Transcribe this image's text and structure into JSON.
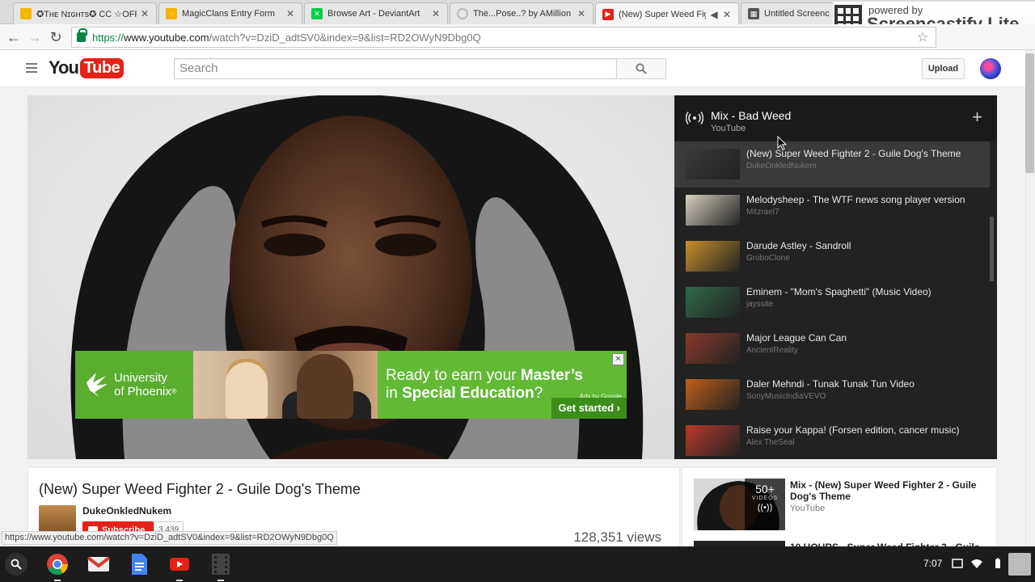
{
  "browser": {
    "tabs": [
      {
        "title": "✪Tʜᴇ Nɪɢʜᴛs✪ CC ☆OFF",
        "favicon": "bulb-icon",
        "color": "#f4b400"
      },
      {
        "title": "MagicClans Entry Form",
        "favicon": "bulb-icon",
        "color": "#f4b400"
      },
      {
        "title": "Browse Art - DeviantArt",
        "favicon": "deviantart-icon",
        "color": "#05cc47"
      },
      {
        "title": "The...Pose..? by AMillion",
        "favicon": "loading-icon",
        "color": "#999999"
      },
      {
        "title": "(New) Super Weed Fig",
        "favicon": "youtube-icon",
        "color": "#e62117"
      },
      {
        "title": "Untitled Screenc",
        "favicon": "screencast-icon",
        "color": "#555555"
      }
    ],
    "url": {
      "scheme": "https://",
      "host": "www.youtube.com",
      "path": "/watch?v=DziD_adtSV0&index=9&list=RD2OWyN9Dbg0Q"
    },
    "status_url": "https://www.youtube.com/watch?v=DziD_adtSV0&index=9&list=RD2OWyN9Dbg0Q"
  },
  "overlay": {
    "powered_by": "powered by",
    "brand": "Screencastify Lite"
  },
  "youtube": {
    "logo_you": "You",
    "logo_tube": "Tube",
    "search_placeholder": "Search",
    "upload_label": "Upload"
  },
  "ad": {
    "brand_line1": "University",
    "brand_line2": "of Phoenix",
    "brand_mark": "®",
    "copy_line1_pre": "Ready to earn your ",
    "copy_line1_bold": "Master’s",
    "copy_line2_pre": "in ",
    "copy_line2_bold": "Special Education",
    "copy_line2_post": "?",
    "label": "Ads by Google",
    "cta": "Get started ›",
    "close": "×"
  },
  "playlist": {
    "title": "Mix - Bad Weed",
    "owner": "YouTube",
    "add": "+",
    "items": [
      {
        "title": "(New) Super Weed Fighter 2 - Guile Dog's Theme",
        "channel": "DukeOnkledNukem",
        "thumb": "#3a3a3a"
      },
      {
        "title": "Melodysheep - The WTF news song player version",
        "channel": "Mitzrael7",
        "thumb": "#d8d0c0"
      },
      {
        "title": "Darude Astley - Sandroll",
        "channel": "GroboClone",
        "thumb": "#c8902a"
      },
      {
        "title": "Eminem - \"Mom's Spaghetti\" (Music Video)",
        "channel": "jayssite",
        "thumb": "#2f6a4a"
      },
      {
        "title": "Major League Can Can",
        "channel": "AncientReality",
        "thumb": "#8a3a2a"
      },
      {
        "title": "Daler Mehndi - Tunak Tunak Tun Video",
        "channel": "SonyMusicIndiaVEVO",
        "thumb": "#c0601a"
      },
      {
        "title": "Raise your Kappa! (Forsen edition, cancer music)",
        "channel": "Alex TheSeal",
        "thumb": "#b83a2a"
      }
    ]
  },
  "video": {
    "title": "(New) Super Weed Fighter 2 - Guile Dog's Theme",
    "channel": "DukeOnkledNukem",
    "subscribe_label": "Subscribe",
    "subscriber_count": "3,439",
    "views": "128,351 views"
  },
  "related": {
    "title": "Mix - (New) Super Weed Fighter 2 - Guile Dog's Theme",
    "owner": "YouTube",
    "count": "50+",
    "count_label": "VIDEOS",
    "next_title": "10 HOURS - Super Weed Fighter 2 - Guile"
  },
  "taskbar": {
    "time": "7:07"
  }
}
